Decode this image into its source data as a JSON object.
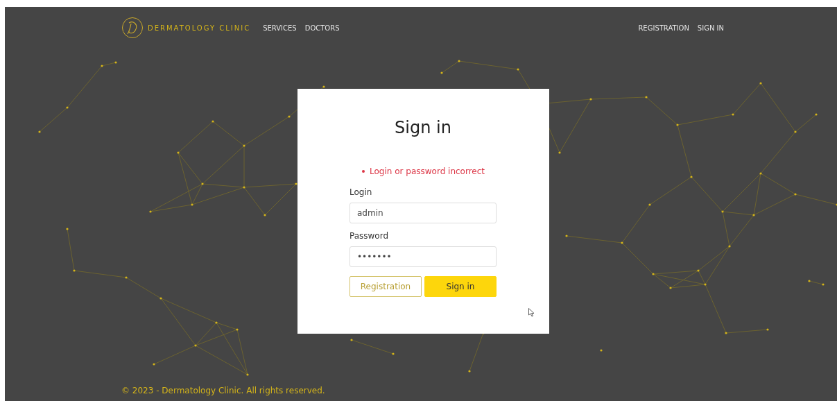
{
  "brand": "DERMATOLOGY CLINIC",
  "nav_left": [
    "SERVICES",
    "DOCTORS"
  ],
  "nav_right": [
    "REGISTRATION",
    "SIGN IN"
  ],
  "form": {
    "title": "Sign in",
    "errors": [
      "Login or password incorrect"
    ],
    "fields": [
      {
        "label": "Login",
        "value": "admin"
      },
      {
        "label": "Password",
        "value": "•••••••"
      }
    ],
    "buttons": [
      {
        "label": "Registration",
        "kind": "outline"
      },
      {
        "label": "Sign in",
        "kind": "primary"
      }
    ]
  },
  "footer": "© 2023 - Dermatology Clinic. All rights reserved."
}
